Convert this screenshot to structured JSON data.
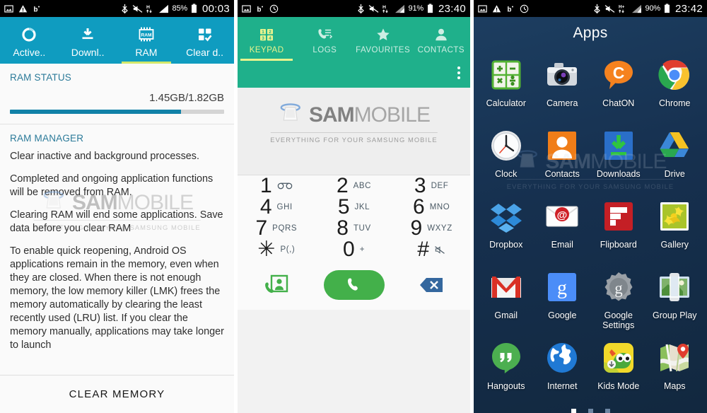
{
  "watermark": {
    "brand_bold": "SAM",
    "brand_light": "MOBILE",
    "tagline": "EVERYTHING FOR YOUR SAMSUNG MOBILE"
  },
  "panel1": {
    "statusbar": {
      "left_icons": [
        "image-icon",
        "warning-icon",
        "blue-b-icon"
      ],
      "right_icons": [
        "bluetooth-icon",
        "mute-icon",
        "hspa-icon",
        "signal-icon"
      ],
      "battery_percent": "85%",
      "clock": "00:03"
    },
    "accent_color": "#0f9cc0",
    "tabs": [
      {
        "label": "Active..",
        "icon": "circle-ring-icon",
        "selected": false
      },
      {
        "label": "Downl..",
        "icon": "download-icon",
        "selected": false
      },
      {
        "label": "RAM",
        "icon": "ram-chip-icon",
        "selected": true
      },
      {
        "label": "Clear d..",
        "icon": "clear-data-icon",
        "selected": false
      }
    ],
    "ram_status": {
      "section_title": "RAM STATUS",
      "value": "1.45GB/1.82GB",
      "used_gb": 1.45,
      "total_gb": 1.82,
      "percent": 80
    },
    "ram_manager": {
      "section_title": "RAM MANAGER",
      "paragraphs": [
        "Clear inactive and background processes.",
        "Completed and ongoing application functions will be removed from RAM.",
        "Clearing RAM will end some applications. Save data before you clear RAM",
        "To enable quick reopening, Android OS applications remain in the memory, even when they are closed. When there is not enough memory, the low memory killer (LMK) frees the memory automatically by clearing the least recently used (LRU) list. If you clear the memory manually, applications may take longer to launch"
      ]
    },
    "clear_button": "CLEAR MEMORY"
  },
  "panel2": {
    "statusbar": {
      "left_icons": [
        "image-icon",
        "blue-b-icon",
        "clock-icon"
      ],
      "right_icons": [
        "bluetooth-icon",
        "mute-icon",
        "hspa-icon",
        "signal-icon"
      ],
      "battery_percent": "91%",
      "clock": "23:40"
    },
    "accent_color": "#1fb08b",
    "tabs": [
      {
        "label": "KEYPAD",
        "icon": "keypad-icon",
        "selected": true
      },
      {
        "label": "LOGS",
        "icon": "call-logs-icon",
        "selected": false
      },
      {
        "label": "FAVOURITES",
        "icon": "star-icon",
        "selected": false
      },
      {
        "label": "CONTACTS",
        "icon": "contact-person-icon",
        "selected": false
      }
    ],
    "overflow_icon": "kebab-menu-icon",
    "dialer_input_value": "",
    "keys": [
      {
        "num": "1",
        "sub": "voicemail-icon"
      },
      {
        "num": "2",
        "sub": "ABC"
      },
      {
        "num": "3",
        "sub": "DEF"
      },
      {
        "num": "4",
        "sub": "GHI"
      },
      {
        "num": "5",
        "sub": "JKL"
      },
      {
        "num": "6",
        "sub": "MNO"
      },
      {
        "num": "7",
        "sub": "PQRS"
      },
      {
        "num": "8",
        "sub": "TUV"
      },
      {
        "num": "9",
        "sub": "WXYZ"
      },
      {
        "num": "✳",
        "sub": "P(,)"
      },
      {
        "num": "0",
        "sub": "+"
      },
      {
        "num": "#",
        "sub": "mute-icon"
      }
    ],
    "actions": [
      {
        "name": "add-contact-button",
        "icon": "add-contact-icon"
      },
      {
        "name": "call-button",
        "icon": "phone-handset-icon"
      },
      {
        "name": "backspace-button",
        "icon": "backspace-icon"
      }
    ]
  },
  "panel3": {
    "statusbar": {
      "left_icons": [
        "image-icon",
        "warning-icon",
        "blue-b-icon",
        "clock-icon"
      ],
      "right_icons": [
        "bluetooth-icon",
        "mute-icon",
        "hspa-plus-icon",
        "signal-icon"
      ],
      "battery_percent": "90%",
      "clock": "23:42"
    },
    "title": "Apps",
    "apps": [
      {
        "label": "Calculator",
        "icon": "calculator-icon"
      },
      {
        "label": "Camera",
        "icon": "camera-icon"
      },
      {
        "label": "ChatON",
        "icon": "chaton-icon"
      },
      {
        "label": "Chrome",
        "icon": "chrome-icon"
      },
      {
        "label": "Clock",
        "icon": "clock-icon"
      },
      {
        "label": "Contacts",
        "icon": "contacts-icon"
      },
      {
        "label": "Downloads",
        "icon": "downloads-icon"
      },
      {
        "label": "Drive",
        "icon": "drive-icon"
      },
      {
        "label": "Dropbox",
        "icon": "dropbox-icon"
      },
      {
        "label": "Email",
        "icon": "email-icon"
      },
      {
        "label": "Flipboard",
        "icon": "flipboard-icon"
      },
      {
        "label": "Gallery",
        "icon": "gallery-icon"
      },
      {
        "label": "Gmail",
        "icon": "gmail-icon"
      },
      {
        "label": "Google",
        "icon": "google-icon"
      },
      {
        "label": "Google Settings",
        "icon": "google-settings-icon"
      },
      {
        "label": "Group Play",
        "icon": "group-play-icon"
      },
      {
        "label": "Hangouts",
        "icon": "hangouts-icon"
      },
      {
        "label": "Internet",
        "icon": "internet-icon"
      },
      {
        "label": "Kids Mode",
        "icon": "kids-mode-icon"
      },
      {
        "label": "Maps",
        "icon": "maps-icon"
      }
    ],
    "page_dots": {
      "count": 3,
      "active_index": 0
    }
  }
}
